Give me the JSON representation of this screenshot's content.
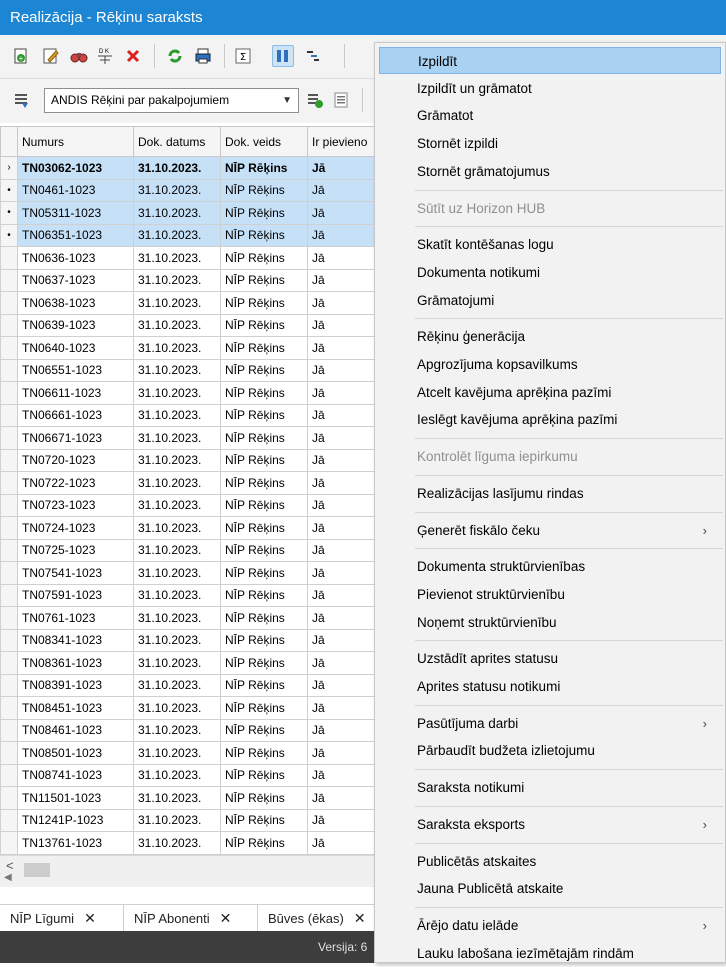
{
  "window": {
    "title": "Realizācija - Rēķinu saraksts"
  },
  "toolbar": {
    "icons": [
      "new-document-icon",
      "edit-pencil-icon",
      "binoculars-icon",
      "debit-credit-icon",
      "delete-x-icon",
      "refresh-icon",
      "print-icon",
      "sum-icon",
      "columns-icon",
      "tree-icon"
    ],
    "filter_select_value": "ANDIS Rēķini par pakalpojumiem"
  },
  "grid": {
    "columns": [
      "Numurs",
      "Dok. datums",
      "Dok. veids",
      "Ir pievieno"
    ],
    "rows": [
      {
        "ind": "›",
        "numurs": "TN03062-1023",
        "datums": "31.10.2023.",
        "veids": "NĪP Rēķins",
        "ir": "Jā",
        "sel": true,
        "cur": true
      },
      {
        "ind": "•",
        "numurs": "TN0461-1023",
        "datums": "31.10.2023.",
        "veids": "NĪP Rēķins",
        "ir": "Jā",
        "sel": true
      },
      {
        "ind": "•",
        "numurs": "TN05311-1023",
        "datums": "31.10.2023.",
        "veids": "NĪP Rēķins",
        "ir": "Jā",
        "sel": true
      },
      {
        "ind": "•",
        "numurs": "TN06351-1023",
        "datums": "31.10.2023.",
        "veids": "NĪP Rēķins",
        "ir": "Jā",
        "sel": true
      },
      {
        "ind": "",
        "numurs": "TN0636-1023",
        "datums": "31.10.2023.",
        "veids": "NĪP Rēķins",
        "ir": "Jā"
      },
      {
        "ind": "",
        "numurs": "TN0637-1023",
        "datums": "31.10.2023.",
        "veids": "NĪP Rēķins",
        "ir": "Jā"
      },
      {
        "ind": "",
        "numurs": "TN0638-1023",
        "datums": "31.10.2023.",
        "veids": "NĪP Rēķins",
        "ir": "Jā"
      },
      {
        "ind": "",
        "numurs": "TN0639-1023",
        "datums": "31.10.2023.",
        "veids": "NĪP Rēķins",
        "ir": "Jā"
      },
      {
        "ind": "",
        "numurs": "TN0640-1023",
        "datums": "31.10.2023.",
        "veids": "NĪP Rēķins",
        "ir": "Jā"
      },
      {
        "ind": "",
        "numurs": "TN06551-1023",
        "datums": "31.10.2023.",
        "veids": "NĪP Rēķins",
        "ir": "Jā"
      },
      {
        "ind": "",
        "numurs": "TN06611-1023",
        "datums": "31.10.2023.",
        "veids": "NĪP Rēķins",
        "ir": "Jā"
      },
      {
        "ind": "",
        "numurs": "TN06661-1023",
        "datums": "31.10.2023.",
        "veids": "NĪP Rēķins",
        "ir": "Jā"
      },
      {
        "ind": "",
        "numurs": "TN06671-1023",
        "datums": "31.10.2023.",
        "veids": "NĪP Rēķins",
        "ir": "Jā"
      },
      {
        "ind": "",
        "numurs": "TN0720-1023",
        "datums": "31.10.2023.",
        "veids": "NĪP Rēķins",
        "ir": "Jā"
      },
      {
        "ind": "",
        "numurs": "TN0722-1023",
        "datums": "31.10.2023.",
        "veids": "NĪP Rēķins",
        "ir": "Jā"
      },
      {
        "ind": "",
        "numurs": "TN0723-1023",
        "datums": "31.10.2023.",
        "veids": "NĪP Rēķins",
        "ir": "Jā"
      },
      {
        "ind": "",
        "numurs": "TN0724-1023",
        "datums": "31.10.2023.",
        "veids": "NĪP Rēķins",
        "ir": "Jā"
      },
      {
        "ind": "",
        "numurs": "TN0725-1023",
        "datums": "31.10.2023.",
        "veids": "NĪP Rēķins",
        "ir": "Jā"
      },
      {
        "ind": "",
        "numurs": "TN07541-1023",
        "datums": "31.10.2023.",
        "veids": "NĪP Rēķins",
        "ir": "Jā"
      },
      {
        "ind": "",
        "numurs": "TN07591-1023",
        "datums": "31.10.2023.",
        "veids": "NĪP Rēķins",
        "ir": "Jā"
      },
      {
        "ind": "",
        "numurs": "TN0761-1023",
        "datums": "31.10.2023.",
        "veids": "NĪP Rēķins",
        "ir": "Jā"
      },
      {
        "ind": "",
        "numurs": "TN08341-1023",
        "datums": "31.10.2023.",
        "veids": "NĪP Rēķins",
        "ir": "Jā"
      },
      {
        "ind": "",
        "numurs": "TN08361-1023",
        "datums": "31.10.2023.",
        "veids": "NĪP Rēķins",
        "ir": "Jā"
      },
      {
        "ind": "",
        "numurs": "TN08391-1023",
        "datums": "31.10.2023.",
        "veids": "NĪP Rēķins",
        "ir": "Jā"
      },
      {
        "ind": "",
        "numurs": "TN08451-1023",
        "datums": "31.10.2023.",
        "veids": "NĪP Rēķins",
        "ir": "Jā"
      },
      {
        "ind": "",
        "numurs": "TN08461-1023",
        "datums": "31.10.2023.",
        "veids": "NĪP Rēķins",
        "ir": "Jā"
      },
      {
        "ind": "",
        "numurs": "TN08501-1023",
        "datums": "31.10.2023.",
        "veids": "NĪP Rēķins",
        "ir": "Jā"
      },
      {
        "ind": "",
        "numurs": "TN08741-1023",
        "datums": "31.10.2023.",
        "veids": "NĪP Rēķins",
        "ir": "Jā"
      },
      {
        "ind": "",
        "numurs": "TN11501-1023",
        "datums": "31.10.2023.",
        "veids": "NĪP Rēķins",
        "ir": "Jā"
      },
      {
        "ind": "",
        "numurs": "TN1241P-1023",
        "datums": "31.10.2023.",
        "veids": "NĪP Rēķins",
        "ir": "Jā"
      },
      {
        "ind": "",
        "numurs": "TN13761-1023",
        "datums": "31.10.2023.",
        "veids": "NĪP Rēķins",
        "ir": "Jā"
      }
    ]
  },
  "tabs": [
    {
      "label": "NĪP Līgumi"
    },
    {
      "label": "NĪP Abonenti"
    },
    {
      "label": "Būves (ēkas)"
    }
  ],
  "status": {
    "version": "Versija: 6"
  },
  "context_menu": {
    "items": [
      {
        "label": "Izpildīt",
        "hl": true
      },
      {
        "label": "Izpildīt un grāmatot"
      },
      {
        "label": "Grāmatot"
      },
      {
        "label": "Stornēt izpildi"
      },
      {
        "label": "Stornēt grāmatojumus"
      },
      {
        "sep": true
      },
      {
        "label": "Sūtīt uz Horizon HUB",
        "dis": true
      },
      {
        "sep": true
      },
      {
        "label": "Skatīt kontēšanas logu"
      },
      {
        "label": "Dokumenta notikumi"
      },
      {
        "label": "Grāmatojumi"
      },
      {
        "sep": true
      },
      {
        "label": "Rēķinu ģenerācija"
      },
      {
        "label": "Apgrozījuma kopsavilkums"
      },
      {
        "label": "Atcelt kavējuma aprēķina pazīmi"
      },
      {
        "label": "Ieslēgt kavējuma aprēķina pazīmi"
      },
      {
        "sep": true
      },
      {
        "label": "Kontrolēt līguma iepirkumu",
        "dis": true
      },
      {
        "sep": true
      },
      {
        "label": "Realizācijas lasījumu rindas"
      },
      {
        "sep": true
      },
      {
        "label": "Ģenerēt fiskālo čeku",
        "sub": true
      },
      {
        "sep": true
      },
      {
        "label": "Dokumenta struktūrvienības"
      },
      {
        "label": "Pievienot struktūrvienību"
      },
      {
        "label": "Noņemt struktūrvienību"
      },
      {
        "sep": true
      },
      {
        "label": "Uzstādīt aprites statusu"
      },
      {
        "label": "Aprites statusu notikumi"
      },
      {
        "sep": true
      },
      {
        "label": "Pasūtījuma darbi",
        "sub": true
      },
      {
        "label": "Pārbaudīt budžeta izlietojumu"
      },
      {
        "sep": true
      },
      {
        "label": "Saraksta notikumi"
      },
      {
        "sep": true
      },
      {
        "label": "Saraksta eksports",
        "sub": true
      },
      {
        "sep": true
      },
      {
        "label": "Publicētās atskaites"
      },
      {
        "label": "Jauna Publicētā atskaite"
      },
      {
        "sep": true
      },
      {
        "label": "Ārējo datu ielāde",
        "sub": true
      },
      {
        "label": "Lauku labošana iezīmētajām rindām"
      }
    ]
  }
}
